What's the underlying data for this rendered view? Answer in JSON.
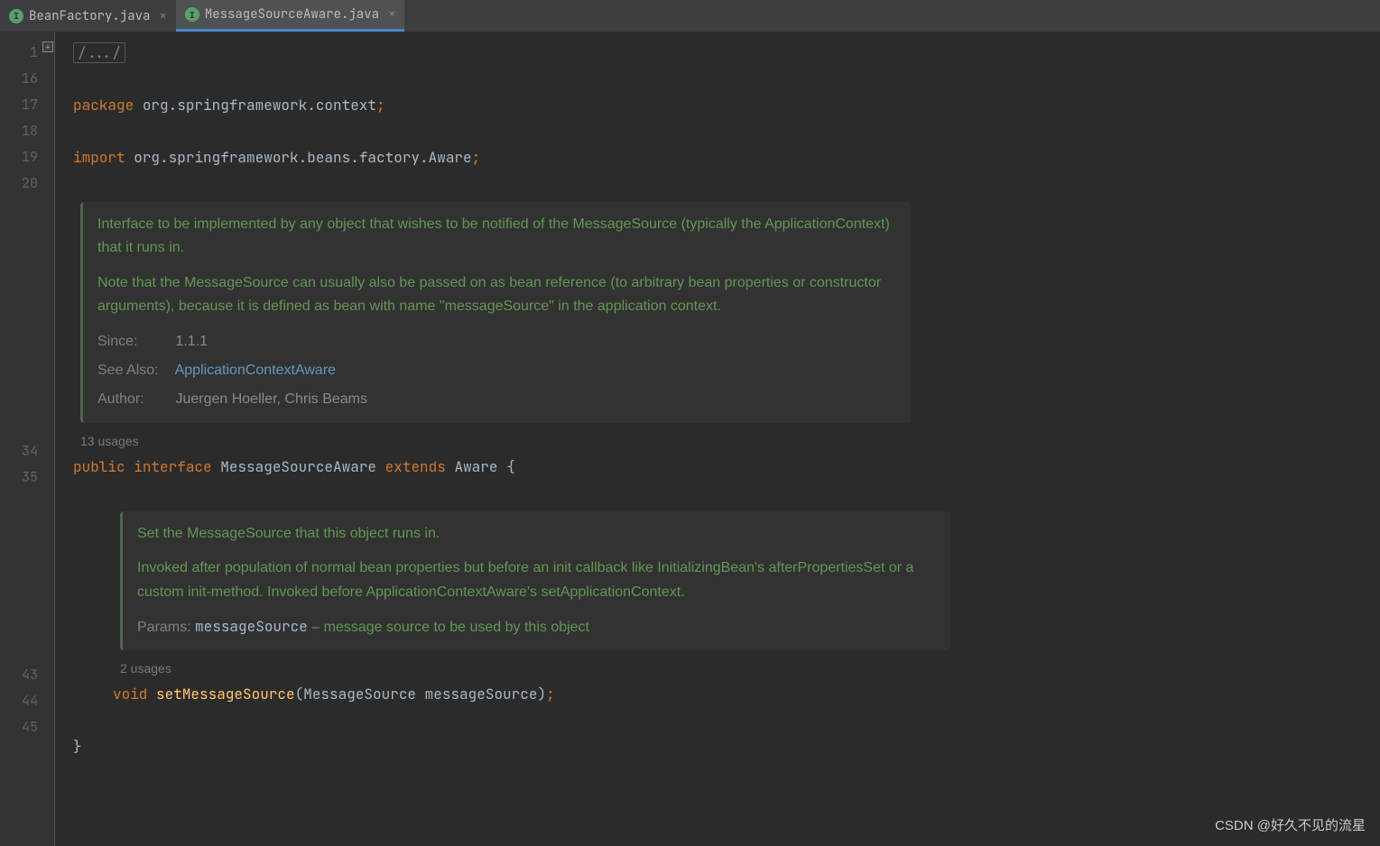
{
  "tabs": [
    {
      "label": "BeanFactory.java",
      "icon_letter": "I"
    },
    {
      "label": "MessageSourceAware.java",
      "icon_letter": "I"
    }
  ],
  "gutter_lines": [
    "1",
    "16",
    "17",
    "18",
    "19",
    "20",
    "34",
    "35",
    "43",
    "44",
    "45"
  ],
  "code": {
    "folded_marker": "/.../",
    "package_kw": "package",
    "package_name": "org.springframework.context",
    "import_kw": "import",
    "import_name": "org.springframework.beans.factory.Aware",
    "public_kw": "public",
    "interface_kw": "interface",
    "interface_name": "MessageSourceAware",
    "extends_kw": "extends",
    "extends_name": "Aware",
    "open_brace": "{",
    "void_kw": "void",
    "method_name": "setMessageSource",
    "param_type": "MessageSource",
    "param_name": "messageSource",
    "close_brace": "}",
    "semicolon": ";"
  },
  "javadoc_class": {
    "p1": "Interface to be implemented by any object that wishes to be notified of the MessageSource (typically the ApplicationContext) that it runs in.",
    "p2": "Note that the MessageSource can usually also be passed on as bean reference (to arbitrary bean properties or constructor arguments), because it is defined as bean with name \"messageSource\" in the application context.",
    "since_label": "Since:",
    "since_value": "1.1.1",
    "seealso_label": "See Also:",
    "seealso_value": "ApplicationContextAware",
    "author_label": "Author:",
    "author_value": "Juergen Hoeller, Chris Beams"
  },
  "javadoc_method": {
    "p1": "Set the MessageSource that this object runs in.",
    "p2": "Invoked after population of normal bean properties but before an init callback like InitializingBean's afterPropertiesSet or a custom init-method. Invoked before ApplicationContextAware's setApplicationContext.",
    "params_label": "Params:",
    "param_name": "messageSource",
    "param_desc": " – message source to be used by this object"
  },
  "usages": {
    "class": "13 usages",
    "method": "2 usages"
  },
  "watermark": "CSDN @好久不见的流星"
}
